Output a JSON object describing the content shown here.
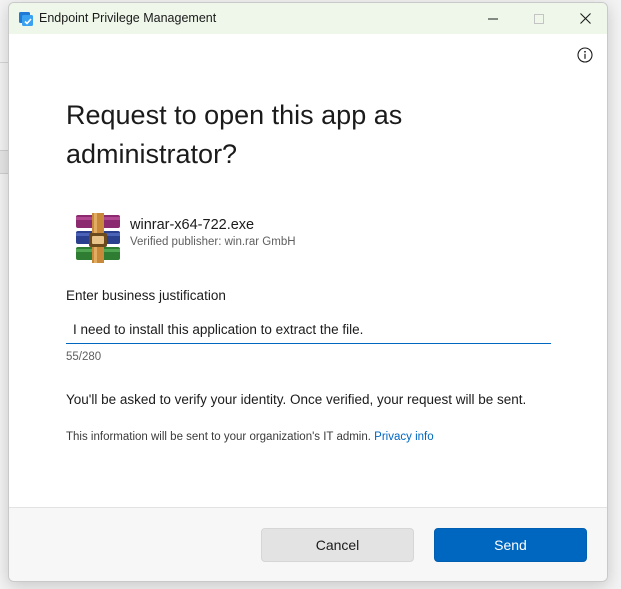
{
  "window": {
    "title": "Endpoint Privilege Management"
  },
  "dialog": {
    "heading": "Request to open this app as administrator?",
    "app": {
      "name": "winrar-x64-722.exe",
      "publisher": "Verified publisher: win.rar GmbH",
      "icon": "winrar-icon"
    },
    "justification": {
      "label": "Enter business justification",
      "value": "I need to install this application to extract the file.",
      "counter": "55/280"
    },
    "verify_text": "You'll be asked to verify your identity. Once verified, your request will be sent.",
    "info_text": "This information will be sent to your organization's IT admin.",
    "privacy_link": "Privacy info"
  },
  "footer": {
    "cancel_label": "Cancel",
    "send_label": "Send"
  },
  "colors": {
    "titlebar": "#eef7e9",
    "accent": "#0067c0",
    "cancel_bg": "#e3e3e3"
  }
}
